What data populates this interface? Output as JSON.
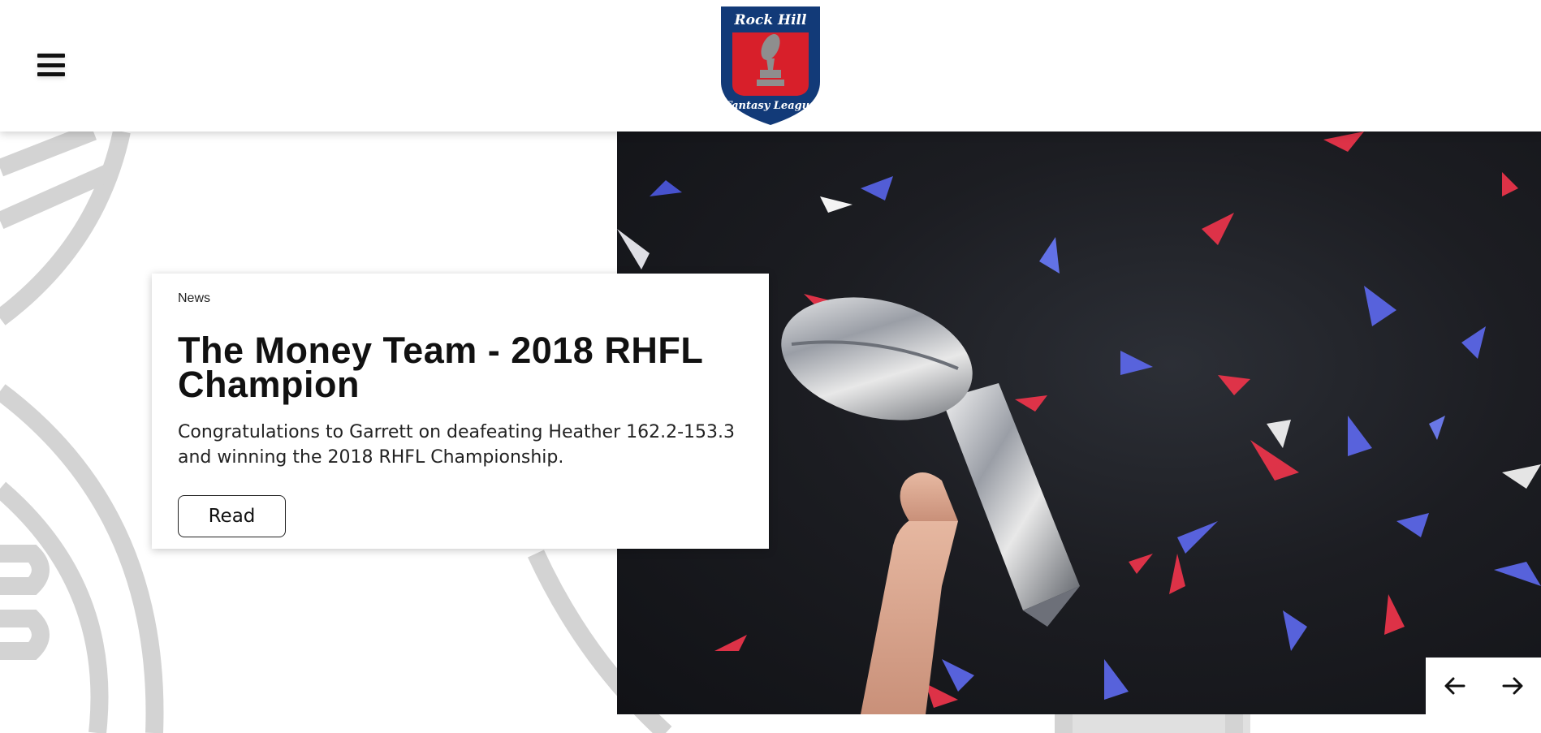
{
  "header": {
    "menu_icon": "hamburger-menu-icon",
    "logo": {
      "top_text": "Rock Hill",
      "bottom_text": "Fantasy League",
      "colors": {
        "navy": "#123a78",
        "red": "#d81f2a",
        "trophy": "#8a8a8a"
      }
    }
  },
  "feature": {
    "category": "News",
    "title": "The Money Team - 2018 RHFL Champion",
    "summary": "Congratulations to Garrett on deafeating Heather 162.2-153.3 and winning the 2018 RHFL Championship.",
    "read_label": "Read",
    "image_description_icon": "trophy-confetti-photo"
  },
  "slider": {
    "prev_icon": "arrow-left-icon",
    "next_icon": "arrow-right-icon"
  },
  "colors": {
    "background": "#ffffff",
    "decoration": "#d6d6d6",
    "text": "#111111"
  }
}
